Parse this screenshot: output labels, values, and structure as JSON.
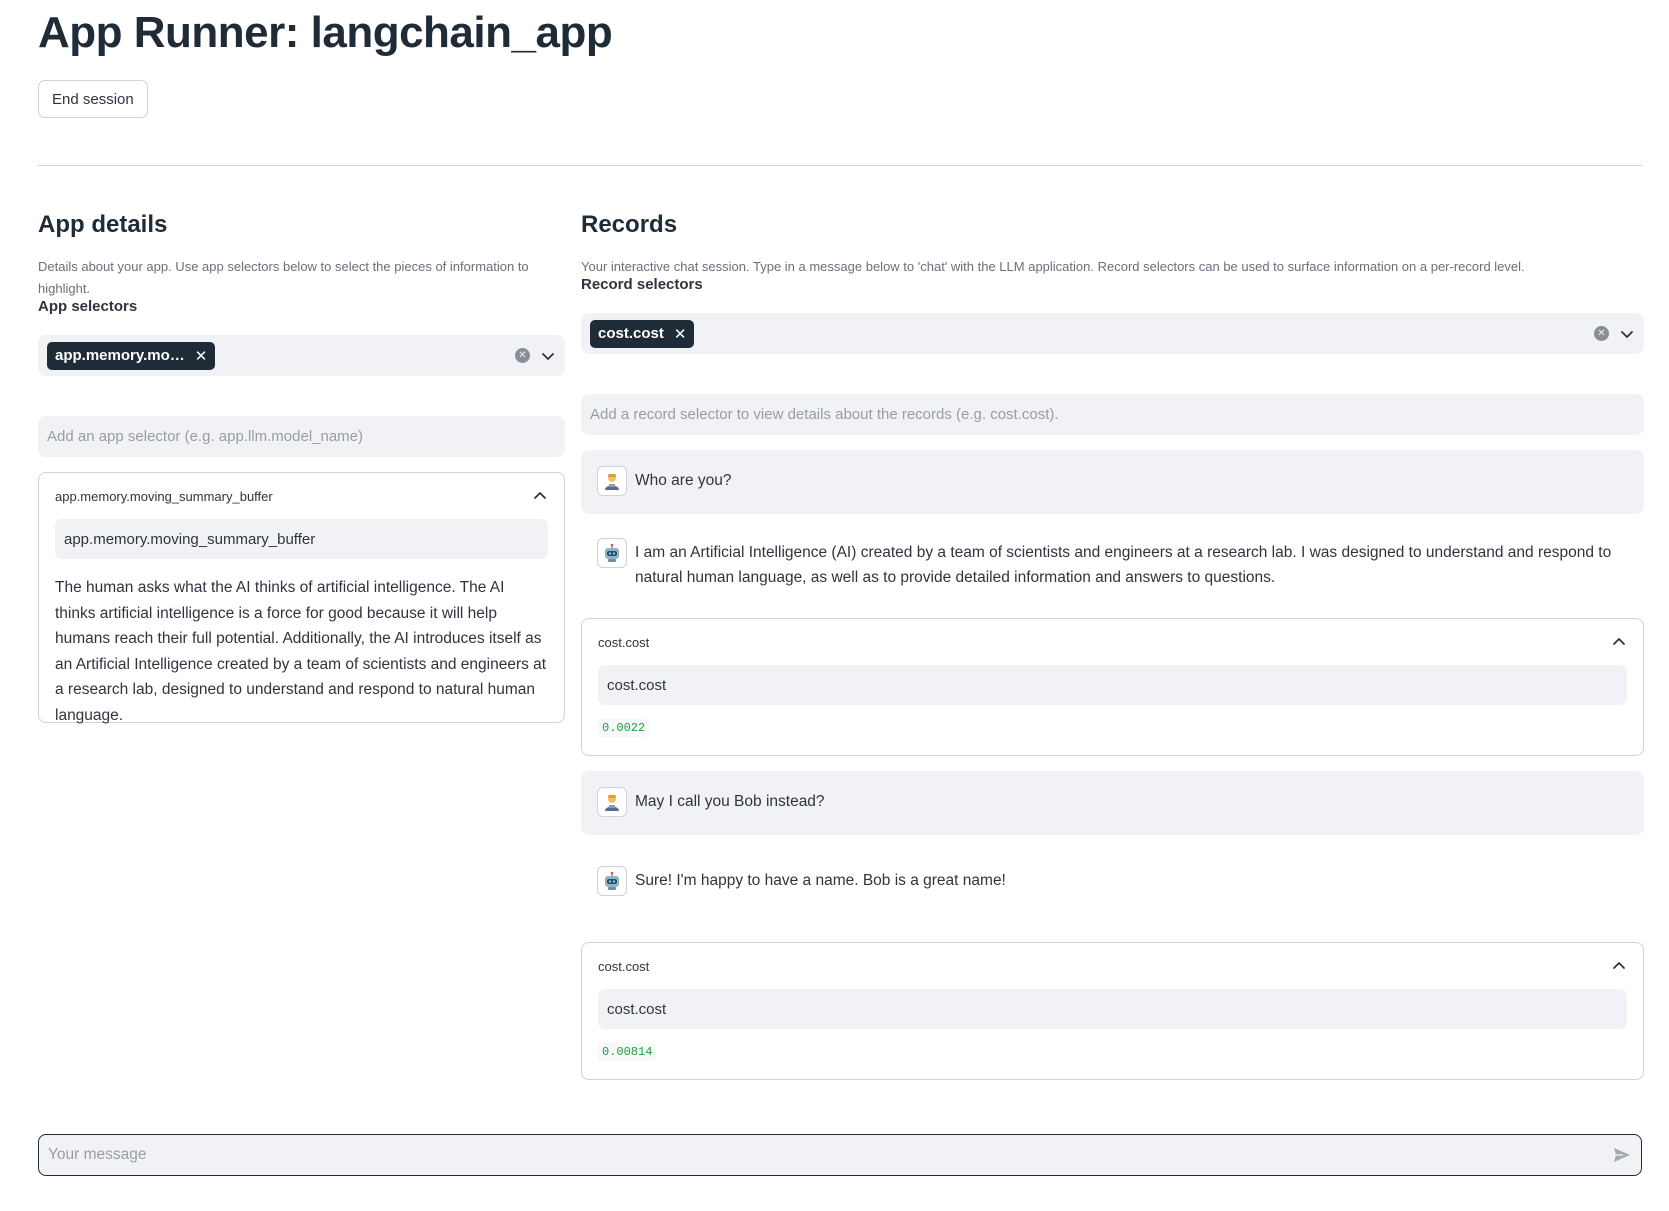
{
  "header": {
    "title": "App Runner: langchain_app",
    "end_session_label": "End session"
  },
  "app_details": {
    "title": "App details",
    "caption": "Details about your app. Use app selectors below to select the pieces of information to highlight.",
    "selectors_label": "App selectors",
    "selected_chip": "app.memory.mo…",
    "input_placeholder": "Add an app selector (e.g. app.llm.model_name)",
    "expander": {
      "header": "app.memory.moving_summary_buffer",
      "field_value": "app.memory.moving_summary_buffer",
      "content": "The human asks what the AI thinks of artificial intelligence. The AI thinks artificial intelligence is a force for good because it will help humans reach their full potential. Additionally, the AI introduces itself as an Artificial Intelligence created by a team of scientists and engineers at a research lab, designed to understand and respond to natural human language."
    }
  },
  "records": {
    "title": "Records",
    "caption": "Your interactive chat session. Type in a message below to 'chat' with the LLM application. Record selectors can be used to surface information on a per-record level.",
    "selectors_label": "Record selectors",
    "selected_chip": "cost.cost",
    "input_placeholder": "Add a record selector to view details about the records (e.g. cost.cost).",
    "messages": [
      {
        "role": "user",
        "avatar_icon": "person-icon",
        "text": "Who are you?"
      },
      {
        "role": "assistant",
        "avatar_icon": "robot-icon",
        "text": "I am an Artificial Intelligence (AI) created by a team of scientists and engineers at a research lab. I was designed to understand and respond to natural human language, as well as to provide detailed information and answers to questions."
      },
      {
        "role": "user",
        "avatar_icon": "person-icon",
        "text": "May I call you Bob instead?"
      },
      {
        "role": "assistant",
        "avatar_icon": "robot-icon",
        "text": "Sure! I'm happy to have a name. Bob is a great name!"
      }
    ],
    "record_details": [
      {
        "header": "cost.cost",
        "field_value": "cost.cost",
        "value": "0.0022"
      },
      {
        "header": "cost.cost",
        "field_value": "cost.cost",
        "value": "0.00814"
      }
    ]
  },
  "chat_input": {
    "placeholder": "Your message"
  },
  "colors": {
    "chip_bg": "#1f2b36",
    "input_bg": "#f0f2f6",
    "value_green": "#21a038",
    "border": "#d0d2d8"
  }
}
